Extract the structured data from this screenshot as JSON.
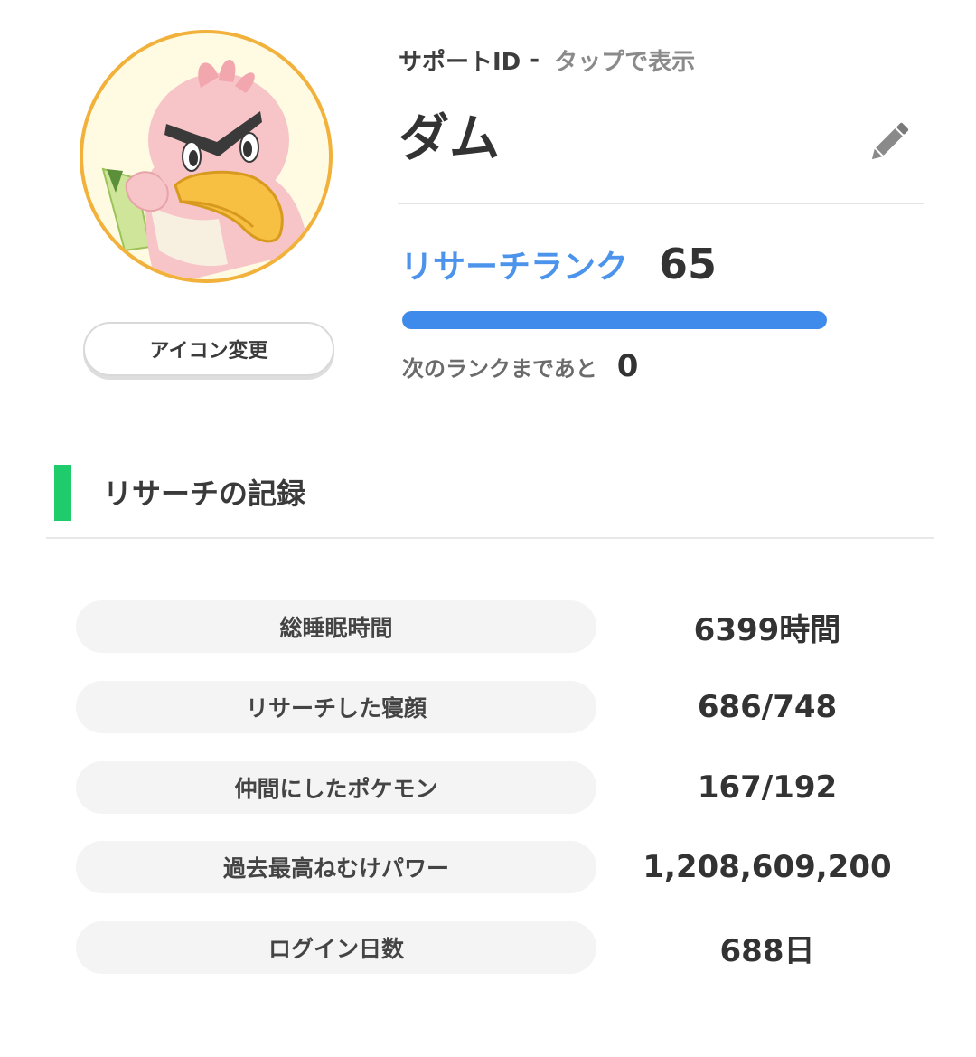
{
  "profile": {
    "support_id_label": "サポートID",
    "support_id_separator": "-",
    "support_id_action": "タップで表示",
    "player_name": "ダム",
    "change_icon_label": "アイコン変更",
    "avatar_icon": "farfetchd-avatar-icon",
    "edit_icon": "pencil-icon"
  },
  "rank": {
    "label": "リサーチランク",
    "value": "65",
    "progress_fraction": 1.0,
    "next_rank_label": "次のランクまであと",
    "next_rank_value": "0"
  },
  "records": {
    "title": "リサーチの記録",
    "items": [
      {
        "label": "総睡眠時間",
        "value": "6399時間"
      },
      {
        "label": "リサーチした寝顔",
        "value": "686/748"
      },
      {
        "label": "仲間にしたポケモン",
        "value": "167/192"
      },
      {
        "label": "過去最高ねむけパワー",
        "value": "1,208,609,200"
      },
      {
        "label": "ログイン日数",
        "value": "688日"
      }
    ]
  },
  "colors": {
    "rank_blue": "#4c93ec",
    "progress_blue": "#3f8bec",
    "section_green": "#1fcc6c",
    "avatar_border": "#f1b13a"
  }
}
